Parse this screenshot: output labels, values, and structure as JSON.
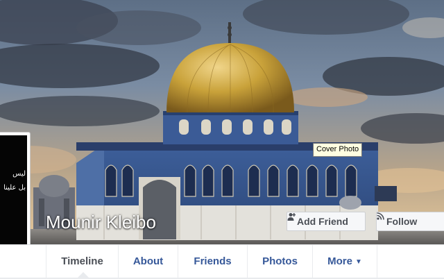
{
  "profile": {
    "name": "Mounir Kleibo",
    "picture_text_line1": "ليس",
    "picture_text_line2": "بل علينا"
  },
  "cover": {
    "tooltip": "Cover Photo"
  },
  "buttons": {
    "add_friend": "Add Friend",
    "follow": "Follow"
  },
  "tabs": [
    {
      "label": "Timeline",
      "active": true
    },
    {
      "label": "About"
    },
    {
      "label": "Friends"
    },
    {
      "label": "Photos"
    },
    {
      "label": "More"
    }
  ],
  "colors": {
    "link": "#365899",
    "nav_bg": "#ffffff",
    "page_bg": "#e9ebee",
    "dome_gold": "#c9a23a"
  },
  "icons": {
    "add_friend": "person-plus-icon",
    "follow": "rss-icon",
    "more": "caret-down-icon"
  }
}
